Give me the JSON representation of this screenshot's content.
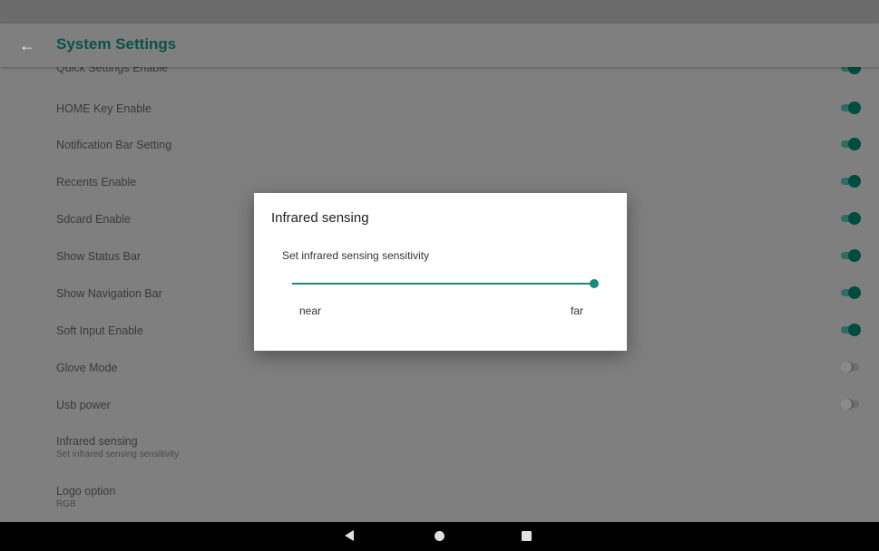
{
  "app_bar": {
    "title": "System Settings",
    "back_icon": "arrow-left-icon"
  },
  "settings": [
    {
      "label": "Quick Settings Enable",
      "switch": "on"
    },
    {
      "label": "HOME Key Enable",
      "switch": "on"
    },
    {
      "label": "Notification Bar Setting",
      "switch": "on"
    },
    {
      "label": "Recents Enable",
      "switch": "on"
    },
    {
      "label": "Sdcard Enable",
      "switch": "on"
    },
    {
      "label": "Show Status Bar",
      "switch": "on"
    },
    {
      "label": "Show Navigation Bar",
      "switch": "on"
    },
    {
      "label": "Soft Input Enable",
      "switch": "on"
    },
    {
      "label": "Glove Mode",
      "switch": "off"
    },
    {
      "label": "Usb power",
      "switch": "off"
    },
    {
      "label": "Infrared sensing",
      "summary": "Set infrared sensing sensitivity"
    },
    {
      "label": "Logo option",
      "summary": "RGB"
    }
  ],
  "dialog": {
    "title": "Infrared sensing",
    "message": "Set infrared sensing sensitivity",
    "slider_value": 1.0,
    "min_label": "near",
    "max_label": "far"
  },
  "nav_bar": {
    "back_icon": "nav-back-icon",
    "home_icon": "nav-home-icon",
    "recents_icon": "nav-recents-icon"
  },
  "colors": {
    "accent": "#1a8a78",
    "title": "#0a5247",
    "switch_on": "#004d40"
  }
}
